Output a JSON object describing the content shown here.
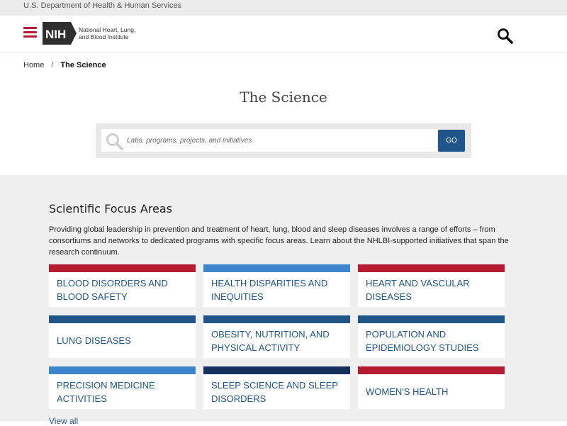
{
  "topbar": {
    "agency": "U.S. Department of Health & Human Services"
  },
  "header": {
    "logo_text": "NIH",
    "institute_line1": "National Heart, Lung,",
    "institute_line2": "and Blood Institute"
  },
  "breadcrumb": {
    "home": "Home",
    "separator": "/",
    "current": "The Science"
  },
  "page": {
    "title": "The Science"
  },
  "search": {
    "placeholder": "Labs, programs, projects, and initiatives",
    "button_label": "GO"
  },
  "focus": {
    "title": "Scientific Focus Areas",
    "description": "Providing global leadership in prevention and treatment of heart, lung, blood and sleep diseases involves a range of efforts – from consortiums and networks to dedicated programs with specific focus areas. Learn about the NHLBI-supported initiatives that span the research continuum.",
    "cards": [
      {
        "label": "BLOOD DISORDERS AND BLOOD SAFETY",
        "bar_color": "#b51b31"
      },
      {
        "label": "HEALTH DISPARITIES AND INEQUITIES",
        "bar_color": "#3c87cc"
      },
      {
        "label": "HEART AND VASCULAR DISEASES",
        "bar_color": "#b51b31"
      },
      {
        "label": "LUNG DISEASES",
        "bar_color": "#20558a"
      },
      {
        "label": "OBESITY, NUTRITION, AND PHYSICAL ACTIVITY",
        "bar_color": "#20558a"
      },
      {
        "label": "POPULATION AND EPIDEMIOLOGY STUDIES",
        "bar_color": "#20558a"
      },
      {
        "label": "PRECISION MEDICINE ACTIVITIES",
        "bar_color": "#3c87cc"
      },
      {
        "label": "SLEEP SCIENCE AND SLEEP DISORDERS",
        "bar_color": "#15305f"
      },
      {
        "label": "WOMEN'S HEALTH",
        "bar_color": "#b51b31"
      }
    ],
    "view_all": "View all"
  },
  "colors": {
    "brand_red": "#b51b31",
    "link_blue": "#20558a",
    "light_blue": "#3c87cc",
    "navy": "#15305f",
    "section_bg": "#efefef"
  }
}
